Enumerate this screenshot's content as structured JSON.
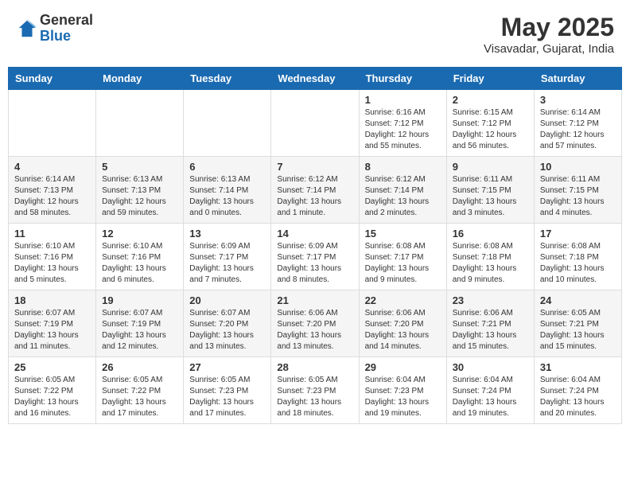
{
  "header": {
    "logo_general": "General",
    "logo_blue": "Blue",
    "month_title": "May 2025",
    "location": "Visavadar, Gujarat, India"
  },
  "days_of_week": [
    "Sunday",
    "Monday",
    "Tuesday",
    "Wednesday",
    "Thursday",
    "Friday",
    "Saturday"
  ],
  "weeks": [
    [
      {
        "day": "",
        "info": ""
      },
      {
        "day": "",
        "info": ""
      },
      {
        "day": "",
        "info": ""
      },
      {
        "day": "",
        "info": ""
      },
      {
        "day": "1",
        "info": "Sunrise: 6:16 AM\nSunset: 7:12 PM\nDaylight: 12 hours\nand 55 minutes."
      },
      {
        "day": "2",
        "info": "Sunrise: 6:15 AM\nSunset: 7:12 PM\nDaylight: 12 hours\nand 56 minutes."
      },
      {
        "day": "3",
        "info": "Sunrise: 6:14 AM\nSunset: 7:12 PM\nDaylight: 12 hours\nand 57 minutes."
      }
    ],
    [
      {
        "day": "4",
        "info": "Sunrise: 6:14 AM\nSunset: 7:13 PM\nDaylight: 12 hours\nand 58 minutes."
      },
      {
        "day": "5",
        "info": "Sunrise: 6:13 AM\nSunset: 7:13 PM\nDaylight: 12 hours\nand 59 minutes."
      },
      {
        "day": "6",
        "info": "Sunrise: 6:13 AM\nSunset: 7:14 PM\nDaylight: 13 hours\nand 0 minutes."
      },
      {
        "day": "7",
        "info": "Sunrise: 6:12 AM\nSunset: 7:14 PM\nDaylight: 13 hours\nand 1 minute."
      },
      {
        "day": "8",
        "info": "Sunrise: 6:12 AM\nSunset: 7:14 PM\nDaylight: 13 hours\nand 2 minutes."
      },
      {
        "day": "9",
        "info": "Sunrise: 6:11 AM\nSunset: 7:15 PM\nDaylight: 13 hours\nand 3 minutes."
      },
      {
        "day": "10",
        "info": "Sunrise: 6:11 AM\nSunset: 7:15 PM\nDaylight: 13 hours\nand 4 minutes."
      }
    ],
    [
      {
        "day": "11",
        "info": "Sunrise: 6:10 AM\nSunset: 7:16 PM\nDaylight: 13 hours\nand 5 minutes."
      },
      {
        "day": "12",
        "info": "Sunrise: 6:10 AM\nSunset: 7:16 PM\nDaylight: 13 hours\nand 6 minutes."
      },
      {
        "day": "13",
        "info": "Sunrise: 6:09 AM\nSunset: 7:17 PM\nDaylight: 13 hours\nand 7 minutes."
      },
      {
        "day": "14",
        "info": "Sunrise: 6:09 AM\nSunset: 7:17 PM\nDaylight: 13 hours\nand 8 minutes."
      },
      {
        "day": "15",
        "info": "Sunrise: 6:08 AM\nSunset: 7:17 PM\nDaylight: 13 hours\nand 9 minutes."
      },
      {
        "day": "16",
        "info": "Sunrise: 6:08 AM\nSunset: 7:18 PM\nDaylight: 13 hours\nand 9 minutes."
      },
      {
        "day": "17",
        "info": "Sunrise: 6:08 AM\nSunset: 7:18 PM\nDaylight: 13 hours\nand 10 minutes."
      }
    ],
    [
      {
        "day": "18",
        "info": "Sunrise: 6:07 AM\nSunset: 7:19 PM\nDaylight: 13 hours\nand 11 minutes."
      },
      {
        "day": "19",
        "info": "Sunrise: 6:07 AM\nSunset: 7:19 PM\nDaylight: 13 hours\nand 12 minutes."
      },
      {
        "day": "20",
        "info": "Sunrise: 6:07 AM\nSunset: 7:20 PM\nDaylight: 13 hours\nand 13 minutes."
      },
      {
        "day": "21",
        "info": "Sunrise: 6:06 AM\nSunset: 7:20 PM\nDaylight: 13 hours\nand 13 minutes."
      },
      {
        "day": "22",
        "info": "Sunrise: 6:06 AM\nSunset: 7:20 PM\nDaylight: 13 hours\nand 14 minutes."
      },
      {
        "day": "23",
        "info": "Sunrise: 6:06 AM\nSunset: 7:21 PM\nDaylight: 13 hours\nand 15 minutes."
      },
      {
        "day": "24",
        "info": "Sunrise: 6:05 AM\nSunset: 7:21 PM\nDaylight: 13 hours\nand 15 minutes."
      }
    ],
    [
      {
        "day": "25",
        "info": "Sunrise: 6:05 AM\nSunset: 7:22 PM\nDaylight: 13 hours\nand 16 minutes."
      },
      {
        "day": "26",
        "info": "Sunrise: 6:05 AM\nSunset: 7:22 PM\nDaylight: 13 hours\nand 17 minutes."
      },
      {
        "day": "27",
        "info": "Sunrise: 6:05 AM\nSunset: 7:23 PM\nDaylight: 13 hours\nand 17 minutes."
      },
      {
        "day": "28",
        "info": "Sunrise: 6:05 AM\nSunset: 7:23 PM\nDaylight: 13 hours\nand 18 minutes."
      },
      {
        "day": "29",
        "info": "Sunrise: 6:04 AM\nSunset: 7:23 PM\nDaylight: 13 hours\nand 19 minutes."
      },
      {
        "day": "30",
        "info": "Sunrise: 6:04 AM\nSunset: 7:24 PM\nDaylight: 13 hours\nand 19 minutes."
      },
      {
        "day": "31",
        "info": "Sunrise: 6:04 AM\nSunset: 7:24 PM\nDaylight: 13 hours\nand 20 minutes."
      }
    ]
  ]
}
